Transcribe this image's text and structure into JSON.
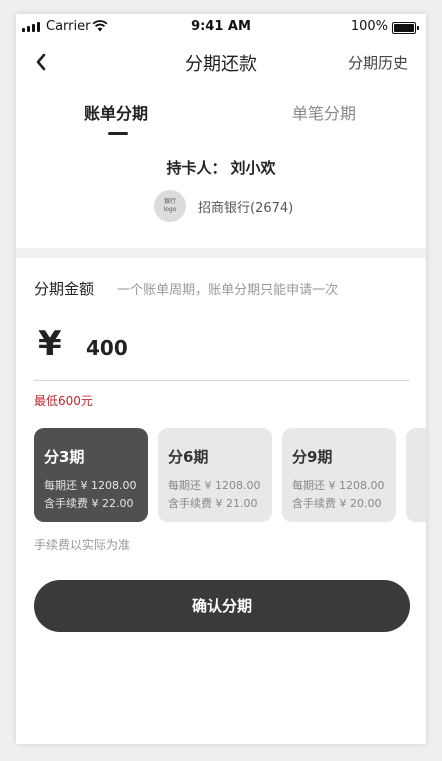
{
  "status_bar": {
    "carrier": "Carrier",
    "time": "9:41 AM",
    "battery": "100%"
  },
  "nav": {
    "title": "分期还款",
    "history_link": "分期历史",
    "back_icon": "chevron-left-icon"
  },
  "tabs": [
    {
      "label": "账单分期",
      "active": true
    },
    {
      "label": "单笔分期",
      "active": false
    }
  ],
  "cardholder": {
    "label": "持卡人：",
    "name": "刘小欢"
  },
  "bank": {
    "logo_line1": "银行",
    "logo_line2": "logo",
    "name": "招商银行(2674)"
  },
  "amount": {
    "label": "分期金额",
    "hint": "一个账单周期，账单分期只能申请一次",
    "currency_symbol": "¥",
    "value": "400",
    "min_note": "最低600元"
  },
  "plans": [
    {
      "title": "分3期",
      "monthly": "每期还 ¥ 1208.00",
      "fee": "含手续费 ¥ 22.00",
      "selected": true
    },
    {
      "title": "分6期",
      "monthly": "每期还 ¥ 1208.00",
      "fee": "含手续费 ¥ 21.00",
      "selected": false
    },
    {
      "title": "分9期",
      "monthly": "每期还 ¥ 1208.00",
      "fee": "含手续费 ¥ 20.00",
      "selected": false
    },
    {
      "title": "",
      "monthly": "",
      "fee": "",
      "selected": false
    }
  ],
  "fee_note": "手续费以实际为准",
  "confirm_button": "确认分期",
  "colors": {
    "accent_dark": "#3a3a3a",
    "selected_card": "#505050",
    "warning_red": "#c0272d"
  }
}
